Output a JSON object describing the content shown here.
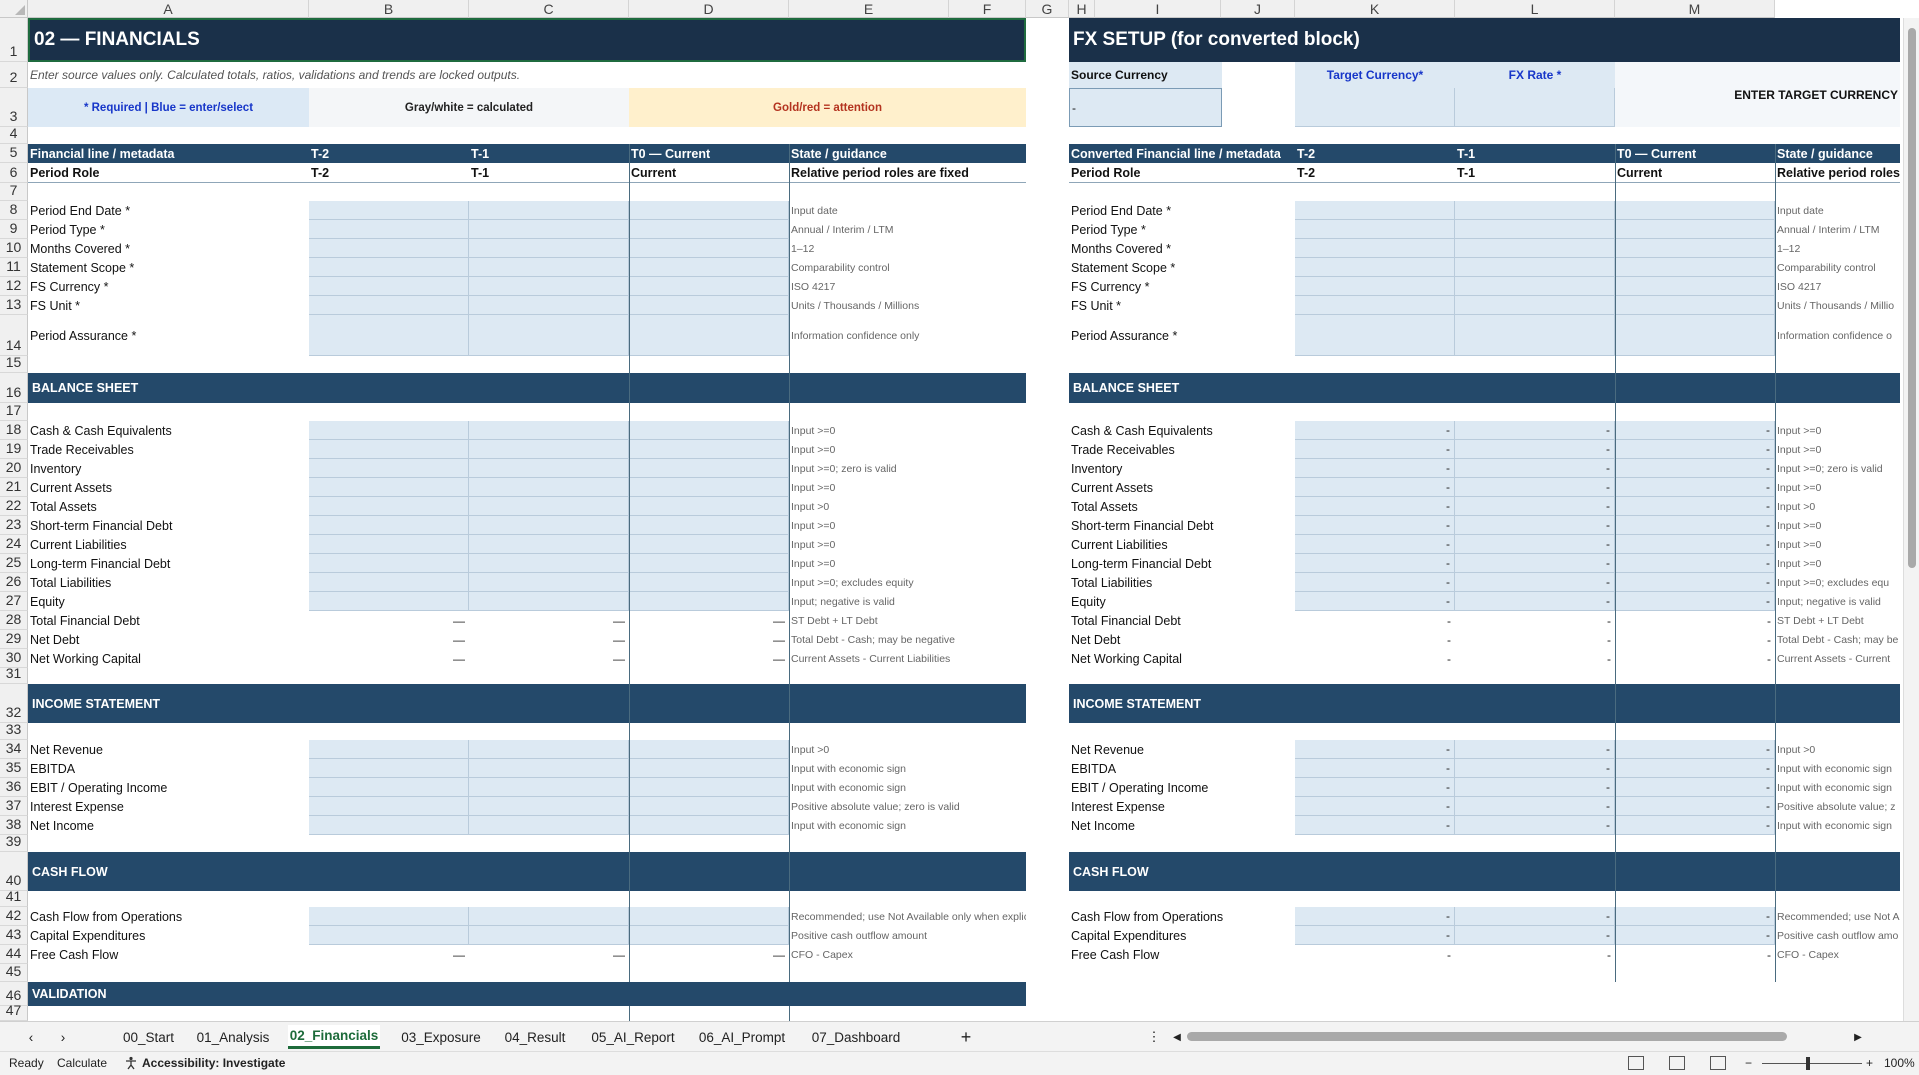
{
  "columns": [
    "A",
    "B",
    "C",
    "D",
    "E",
    "F",
    "G",
    "H",
    "I",
    "J",
    "K",
    "L",
    "M"
  ],
  "rows": [
    "1",
    "2",
    "3",
    "4",
    "5",
    "6",
    "7",
    "8",
    "9",
    "10",
    "11",
    "12",
    "13",
    "14",
    "15",
    "16",
    "17",
    "18",
    "19",
    "20",
    "21",
    "22",
    "23",
    "24",
    "25",
    "26",
    "27",
    "28",
    "29",
    "30",
    "31",
    "32",
    "33",
    "34",
    "35",
    "36",
    "37",
    "38",
    "39",
    "40",
    "41",
    "42",
    "43",
    "44",
    "45",
    "46",
    "47"
  ],
  "left": {
    "title": "02 — FINANCIALS",
    "subtitle": "Enter source values only. Calculated totals, ratios, validations and trends are locked outputs.",
    "legend": {
      "blue": "* Required | Blue = enter/select",
      "gray": "Gray/white = calculated",
      "gold": "Gold/red = attention"
    },
    "col_headers": [
      "Financial line / metadata",
      "T-2",
      "T-1",
      "T0 — Current",
      "State / guidance"
    ],
    "role_row": [
      "Period Role",
      "T-2",
      "T-1",
      "Current",
      "Relative period roles are fixed"
    ],
    "meta": [
      {
        "label": "Period End Date *",
        "guide": "Input date"
      },
      {
        "label": "Period Type *",
        "guide": "Annual / Interim / LTM"
      },
      {
        "label": "Months Covered *",
        "guide": "1–12"
      },
      {
        "label": "Statement Scope *",
        "guide": "Comparability control"
      },
      {
        "label": "FS Currency *",
        "guide": "ISO 4217"
      },
      {
        "label": "FS Unit *",
        "guide": "Units / Thousands / Millions"
      },
      {
        "label": "Period Assurance *",
        "guide": "Information confidence only"
      }
    ],
    "balance_title": "BALANCE SHEET",
    "balance": [
      {
        "label": "Cash & Cash Equivalents",
        "guide": "Input >=0"
      },
      {
        "label": "Trade Receivables",
        "guide": "Input >=0"
      },
      {
        "label": "Inventory",
        "guide": "Input >=0; zero is valid"
      },
      {
        "label": "Current Assets",
        "guide": "Input >=0"
      },
      {
        "label": "Total Assets",
        "guide": "Input >0"
      },
      {
        "label": "Short-term Financial Debt",
        "guide": "Input >=0"
      },
      {
        "label": "Current Liabilities",
        "guide": "Input >=0"
      },
      {
        "label": "Long-term Financial Debt",
        "guide": "Input >=0"
      },
      {
        "label": "Total Liabilities",
        "guide": "Input >=0; excludes equity"
      },
      {
        "label": "Equity",
        "guide": "Input; negative is valid"
      }
    ],
    "balance_calc": [
      {
        "label": "Total Financial Debt",
        "guide": "ST Debt + LT Debt",
        "value": "—"
      },
      {
        "label": "Net Debt",
        "guide": "Total Debt - Cash; may be negative",
        "value": "—"
      },
      {
        "label": "Net Working Capital",
        "guide": "Current Assets - Current Liabilities",
        "value": "—"
      }
    ],
    "income_title": "INCOME STATEMENT",
    "income": [
      {
        "label": "Net Revenue",
        "guide": "Input >0"
      },
      {
        "label": "EBITDA",
        "guide": "Input with economic sign"
      },
      {
        "label": "EBIT / Operating Income",
        "guide": "Input with economic sign"
      },
      {
        "label": "Interest Expense",
        "guide": "Positive absolute value; zero is valid"
      },
      {
        "label": "Net Income",
        "guide": "Input with economic sign"
      }
    ],
    "cash_title": "CASH FLOW",
    "cash": [
      {
        "label": "Cash Flow from Operations",
        "guide": "Recommended; use Not Available only when explicitly una"
      },
      {
        "label": "Capital Expenditures",
        "guide": "Positive cash outflow amount"
      }
    ],
    "cash_calc": [
      {
        "label": "Free Cash Flow",
        "guide": "CFO - Capex",
        "value": "—"
      }
    ],
    "validation_title": "VALIDATION"
  },
  "right": {
    "title": "FX SETUP (for converted block)",
    "source_currency_label": "Source Currency",
    "source_currency_value": "-",
    "target_currency_label": "Target Currency*",
    "fx_rate_label": "FX Rate *",
    "enter_target": "ENTER TARGET CURRENCY",
    "col_headers": [
      "Converted Financial line / metadata",
      "T-2",
      "T-1",
      "T0 — Current",
      "State / guidance"
    ],
    "role_row": [
      "Period Role",
      "T-2",
      "T-1",
      "Current",
      "Relative period roles"
    ],
    "meta": [
      {
        "label": "Period End Date *",
        "guide": "Input date"
      },
      {
        "label": "Period Type *",
        "guide": "Annual / Interim / LTM"
      },
      {
        "label": "Months Covered *",
        "guide": "1–12"
      },
      {
        "label": "Statement Scope *",
        "guide": "Comparability control"
      },
      {
        "label": "FS Currency *",
        "guide": "ISO 4217"
      },
      {
        "label": "FS Unit *",
        "guide": "Units / Thousands / Millio"
      },
      {
        "label": "Period Assurance *",
        "guide": "Information confidence o"
      }
    ],
    "balance_title": "BALANCE SHEET",
    "balance": [
      {
        "label": "Cash & Cash Equivalents",
        "guide": "Input >=0"
      },
      {
        "label": "Trade Receivables",
        "guide": "Input >=0"
      },
      {
        "label": "Inventory",
        "guide": "Input >=0; zero is valid"
      },
      {
        "label": "Current Assets",
        "guide": "Input >=0"
      },
      {
        "label": "Total Assets",
        "guide": "Input >0"
      },
      {
        "label": "Short-term Financial Debt",
        "guide": "Input >=0"
      },
      {
        "label": "Current Liabilities",
        "guide": "Input >=0"
      },
      {
        "label": "Long-term Financial Debt",
        "guide": "Input >=0"
      },
      {
        "label": "Total Liabilities",
        "guide": "Input >=0; excludes equ"
      },
      {
        "label": "Equity",
        "guide": "Input; negative is valid"
      }
    ],
    "balance_calc": [
      {
        "label": "Total Financial Debt",
        "guide": "ST Debt + LT Debt"
      },
      {
        "label": "Net Debt",
        "guide": "Total Debt - Cash; may be"
      },
      {
        "label": "Net Working Capital",
        "guide": "Current Assets - Current"
      }
    ],
    "income_title": "INCOME STATEMENT",
    "income": [
      {
        "label": "Net Revenue",
        "guide": "Input >0"
      },
      {
        "label": "EBITDA",
        "guide": "Input with economic sign"
      },
      {
        "label": "EBIT / Operating Income",
        "guide": "Input with economic sign"
      },
      {
        "label": "Interest Expense",
        "guide": "Positive absolute value; z"
      },
      {
        "label": "Net Income",
        "guide": "Input with economic sign"
      }
    ],
    "cash_title": "CASH FLOW",
    "cash": [
      {
        "label": "Cash Flow from Operations",
        "guide": "Recommended; use Not A"
      },
      {
        "label": "Capital Expenditures",
        "guide": "Positive cash outflow amo"
      },
      {
        "label": "Free Cash Flow",
        "guide": "CFO - Capex"
      }
    ],
    "dash": "-"
  },
  "tabs": [
    "00_Start",
    "01_Analysis",
    "02_Financials",
    "03_Exposure",
    "04_Result",
    "05_AI_Report",
    "06_AI_Prompt",
    "07_Dashboard"
  ],
  "active_tab": "02_Financials",
  "add_sheet": "+",
  "status": {
    "ready": "Ready",
    "calculate": "Calculate",
    "accessibility": "Accessibility: Investigate",
    "zoom": "100%"
  }
}
